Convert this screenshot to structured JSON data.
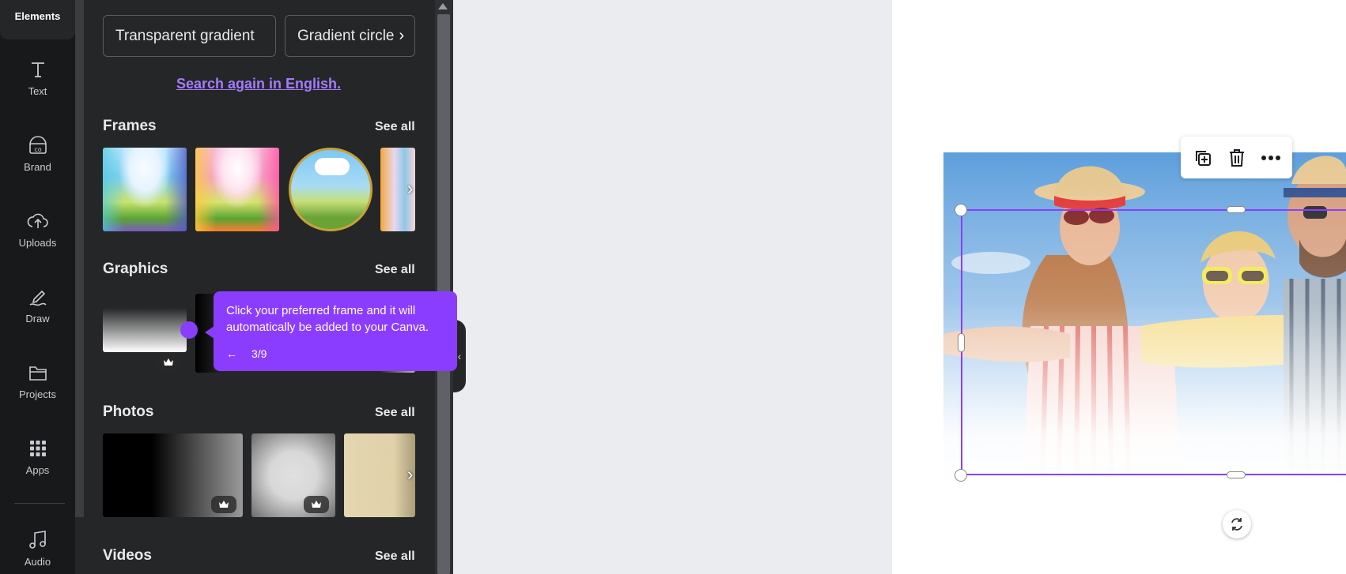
{
  "rail": {
    "items": [
      {
        "label": "Elements",
        "icon": "elements-icon",
        "active": true
      },
      {
        "label": "Text",
        "icon": "text-icon"
      },
      {
        "label": "Brand",
        "icon": "brand-icon"
      },
      {
        "label": "Uploads",
        "icon": "uploads-icon"
      },
      {
        "label": "Draw",
        "icon": "draw-icon"
      },
      {
        "label": "Projects",
        "icon": "projects-icon"
      },
      {
        "label": "Apps",
        "icon": "apps-icon"
      },
      {
        "label": "Audio",
        "icon": "audio-icon"
      }
    ]
  },
  "panel": {
    "chips": [
      "Transparent gradient",
      "Gradient circle"
    ],
    "search_again_link": "Search again in English",
    "search_again_suffix": ".",
    "sections": {
      "frames": {
        "title": "Frames",
        "see_all": "See all"
      },
      "graphics": {
        "title": "Graphics",
        "see_all": "See all"
      },
      "photos": {
        "title": "Photos",
        "see_all": "See all"
      },
      "videos": {
        "title": "Videos",
        "see_all": "See all"
      }
    }
  },
  "tooltip": {
    "text": "Click your preferred frame and it will automatically be added to your Canva.",
    "back_arrow": "←",
    "step": "3/9"
  },
  "canvas": {
    "context_toolbar": [
      "duplicate-icon",
      "trash-icon",
      "more-icon"
    ],
    "rotate_icon": "rotate-icon"
  },
  "colors": {
    "accent": "#8b3dff",
    "link": "#a57aff",
    "rail_bg": "#18191b",
    "panel_bg": "#252627",
    "canvas_bg": "#ebecf0"
  }
}
